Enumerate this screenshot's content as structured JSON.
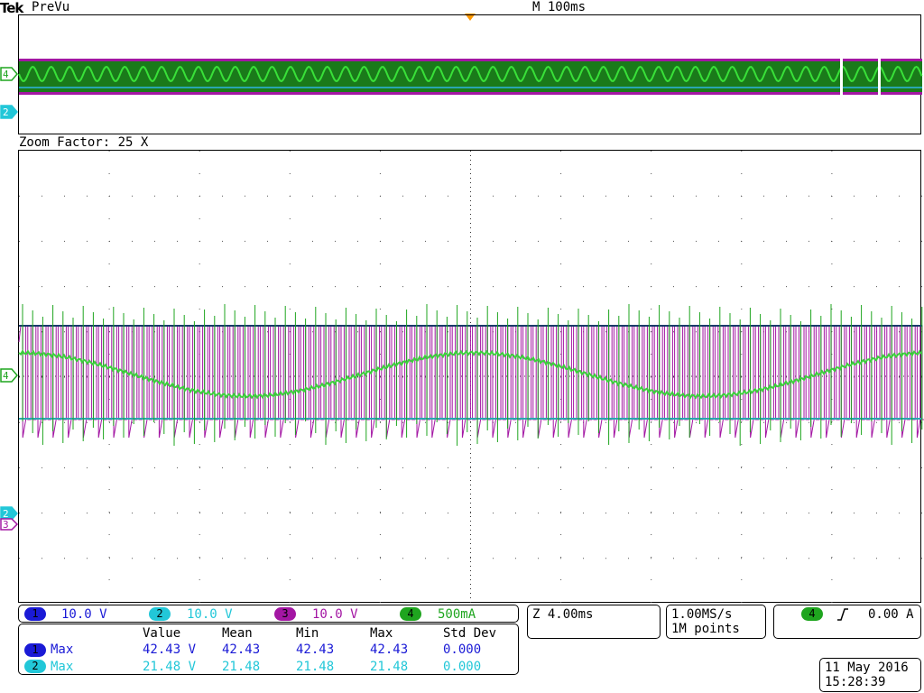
{
  "header": {
    "brand": "Tek",
    "mode": "PreVu",
    "timebase": "M 100ms"
  },
  "zoom_label": "Zoom Factor: 25 X",
  "colors": {
    "ch1": "#1a1ad6",
    "ch2": "#22c7d8",
    "ch3": "#a316a3",
    "ch4": "#1fa51f",
    "trigger_marker": "#ff9900",
    "grid": "#555555"
  },
  "markers": {
    "overview_ch4": "4",
    "overview_ch2": "2",
    "zoom_ch4": "4",
    "zoom_ch2": "2",
    "zoom_ch3": "3"
  },
  "channels": [
    {
      "num": "1",
      "scale": "10.0 V"
    },
    {
      "num": "2",
      "scale": "10.0 V"
    },
    {
      "num": "3",
      "scale": "10.0 V"
    },
    {
      "num": "4",
      "scale": "500mA"
    }
  ],
  "measurements": {
    "headers": [
      "Value",
      "Mean",
      "Min",
      "Max",
      "Std Dev"
    ],
    "rows": [
      {
        "ch": "1",
        "type": "Max",
        "value": "42.43 V",
        "mean": "42.43",
        "min": "42.43",
        "max": "42.43",
        "std": "0.000"
      },
      {
        "ch": "2",
        "type": "Max",
        "value": "21.48 V",
        "mean": "21.48",
        "min": "21.48",
        "max": "21.48",
        "std": "0.000"
      }
    ]
  },
  "zoom_time": "Z 4.00ms",
  "acquisition": {
    "rate": "1.00MS/s",
    "points": "1M points"
  },
  "trigger": {
    "channel": "4",
    "slope_icon": "rising-edge-icon",
    "level": "0.00 A"
  },
  "datetime": {
    "date": "11 May 2016",
    "time": "15:28:39"
  }
}
